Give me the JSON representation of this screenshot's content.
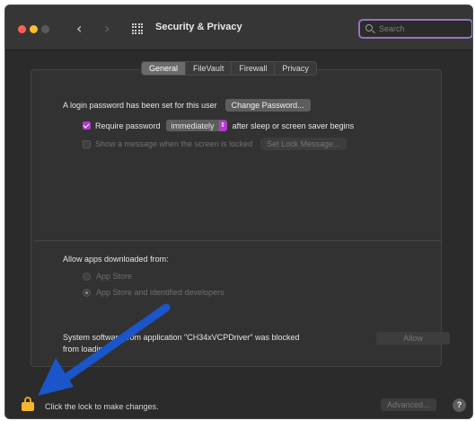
{
  "window": {
    "title": "Security & Privacy",
    "back_glyph": "‹",
    "forward_glyph": "›"
  },
  "search": {
    "placeholder": "Search",
    "icon": "search-icon"
  },
  "tabs": [
    {
      "label": "General",
      "active": true
    },
    {
      "label": "FileVault",
      "active": false
    },
    {
      "label": "Firewall",
      "active": false
    },
    {
      "label": "Privacy",
      "active": false
    }
  ],
  "general": {
    "login_password_text": "A login password has been set for this user",
    "change_password_label": "Change Password...",
    "require_password_label": "Require password",
    "require_password_checked": true,
    "require_password_value": "immediately",
    "require_password_suffix": "after sleep or screen saver begins",
    "show_message_label": "Show a message when the screen is locked",
    "show_message_checked": false,
    "set_lock_message_label": "Set Lock Message..."
  },
  "allow_apps": {
    "heading": "Allow apps downloaded from:",
    "options": [
      {
        "label": "App Store",
        "selected": false
      },
      {
        "label": "App Store and identified developers",
        "selected": true
      }
    ]
  },
  "blocked": {
    "line1": "System software from application \"CH34xVCPDriver\" was blocked",
    "line2": "from loading.",
    "allow_label": "Allow"
  },
  "footer": {
    "lock_text": "Click the lock to make changes.",
    "advanced_label": "Advanced...",
    "help_label": "?"
  },
  "colors": {
    "accent": "#b23ad0",
    "search_ring": "#9b6fbe",
    "lock": "#f5b52e",
    "annotation_arrow": "#1a56c9"
  }
}
